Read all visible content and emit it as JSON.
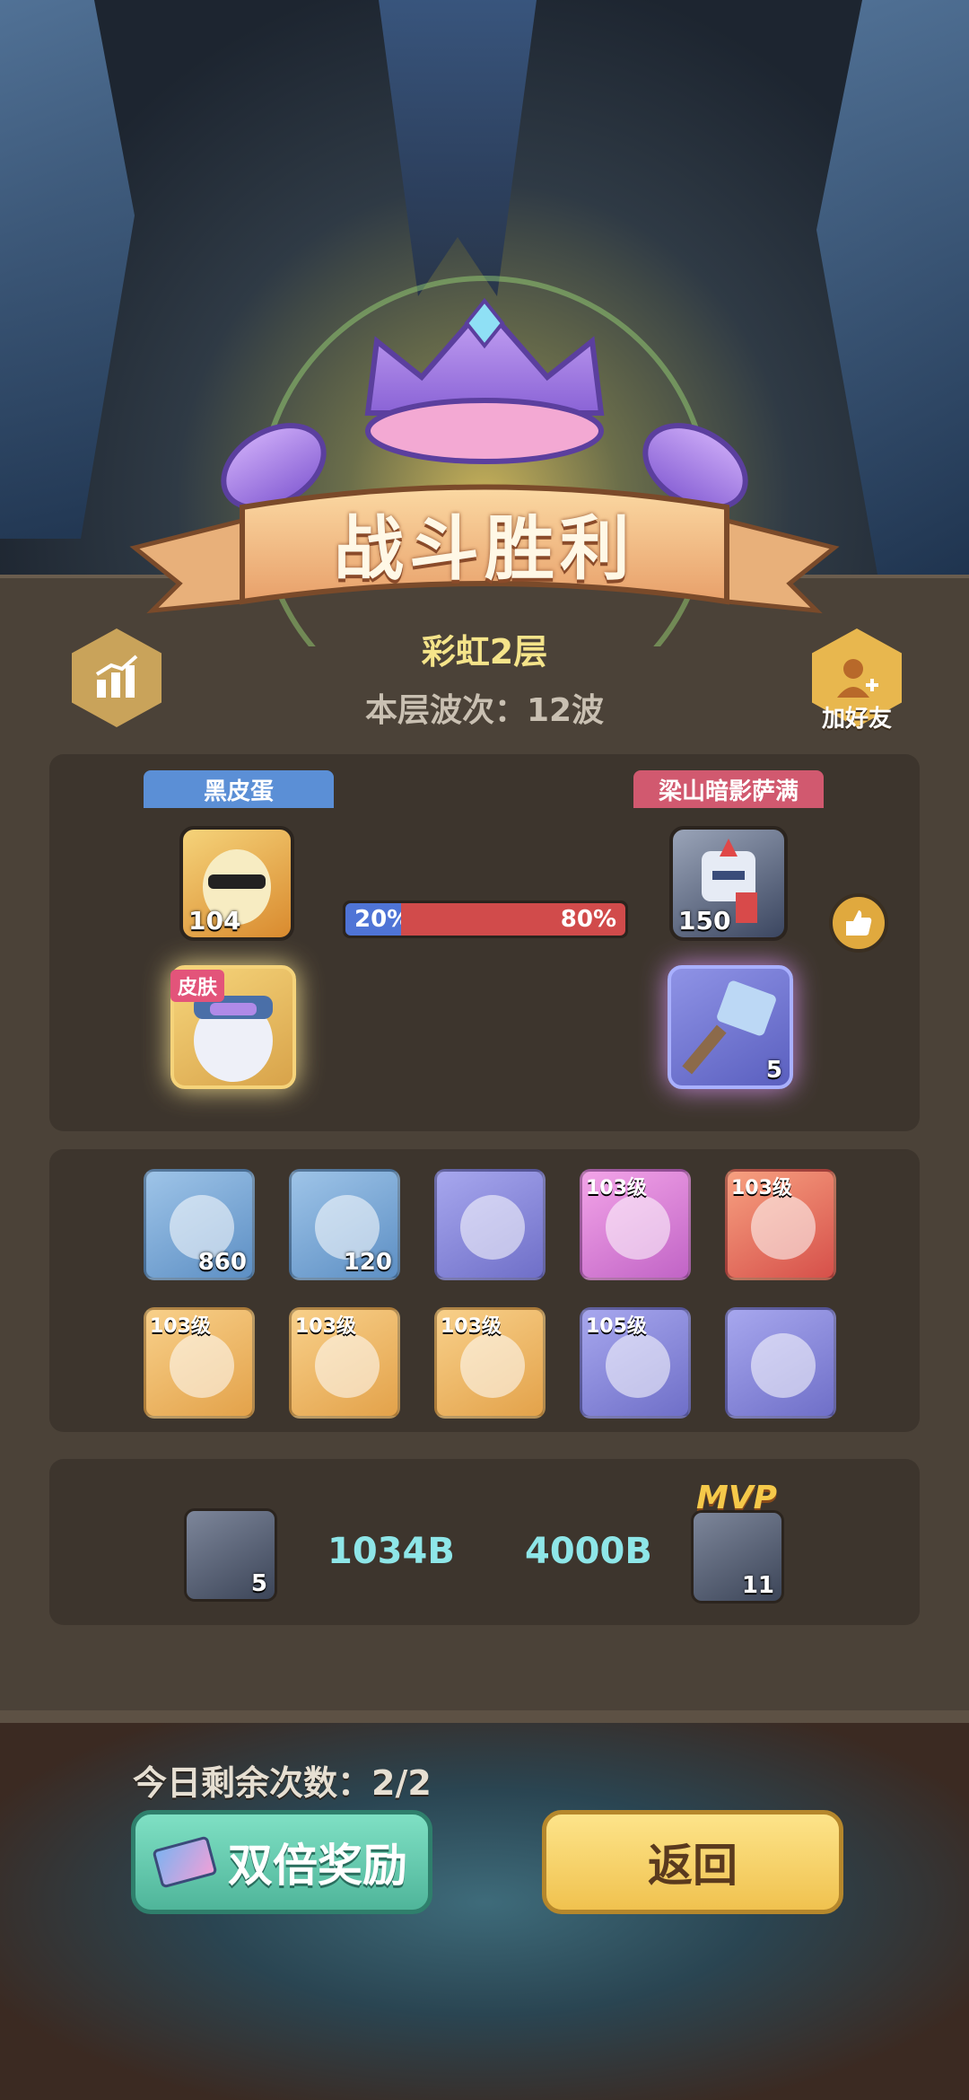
{
  "result": {
    "title": "战斗胜利",
    "floor": "彩虹2层",
    "waves_label": "本层波次：12波"
  },
  "buttons": {
    "add_friend": "加好友"
  },
  "battle": {
    "left_player": {
      "name": "黑皮蛋",
      "hero_level": "104",
      "skin_tag": "皮肤"
    },
    "right_player": {
      "name": "梁山暗影萨满",
      "hero_level": "150",
      "item_count": "5"
    },
    "ratio": {
      "left_label": "20%",
      "right_label": "80%",
      "left_fraction": 0.2
    }
  },
  "rewards": [
    {
      "icon": "coin-icon",
      "qty": "860",
      "level": "",
      "bg": "blue"
    },
    {
      "icon": "exp-icon",
      "qty": "120",
      "level": "",
      "bg": "blue"
    },
    {
      "icon": "hammer-icon",
      "qty": "",
      "level": "",
      "bg": "purple"
    },
    {
      "icon": "amulet-icon",
      "qty": "",
      "level": "103级",
      "bg": "pink"
    },
    {
      "icon": "ring-icon",
      "qty": "",
      "level": "103级",
      "bg": "red"
    },
    {
      "icon": "horn-icon",
      "qty": "",
      "level": "103级",
      "bg": "orange"
    },
    {
      "icon": "amulet-icon",
      "qty": "",
      "level": "103级",
      "bg": "orange"
    },
    {
      "icon": "ring-icon",
      "qty": "",
      "level": "103级",
      "bg": "orange"
    },
    {
      "icon": "armor-icon",
      "qty": "",
      "level": "105级",
      "bg": "purple"
    },
    {
      "icon": "heart-icon",
      "qty": "",
      "level": "",
      "bg": "purple"
    }
  ],
  "damage": {
    "left_count": "5",
    "left_value": "1034B",
    "right_value": "4000B",
    "right_count": "11",
    "mvp_label": "MVP"
  },
  "footer": {
    "remaining": "今日剩余次数：2/2",
    "double_reward": "双倍奖励",
    "return": "返回"
  }
}
